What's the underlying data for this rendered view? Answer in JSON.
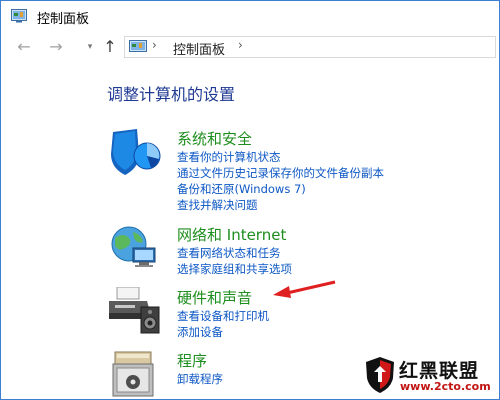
{
  "window": {
    "title": "控制面板"
  },
  "navigation": {
    "back_icon": "arrow-left-icon",
    "forward_icon": "arrow-right-icon",
    "recent_icon": "chevron-down-icon",
    "up_icon": "arrow-up-icon",
    "breadcrumb_separator": "›",
    "address_text": "控制面板"
  },
  "main": {
    "heading": "调整计算机的设置",
    "categories": [
      {
        "title": "系统和安全",
        "icon": "shield-icon",
        "links": [
          "查看你的计算机状态",
          "通过文件历史记录保存你的文件备份副本",
          "备份和还原(Windows 7)",
          "查找并解决问题"
        ]
      },
      {
        "title": "网络和 Internet",
        "icon": "network-globe-icon",
        "links": [
          "查看网络状态和任务",
          "选择家庭组和共享选项"
        ]
      },
      {
        "title": "硬件和声音",
        "icon": "printer-speaker-icon",
        "links": [
          "查看设备和打印机",
          "添加设备"
        ]
      },
      {
        "title": "程序",
        "icon": "programs-icon",
        "links": [
          "卸载程序"
        ]
      }
    ]
  },
  "annotation": {
    "arrow_color": "#e02020"
  },
  "watermark": {
    "title": "红黑联盟",
    "url": "www.2cto.com"
  },
  "colors": {
    "heading": "#1f3a93",
    "category_title": "#1e8e1e",
    "link": "#0e58c5",
    "window_border": "#3b7fd0"
  }
}
